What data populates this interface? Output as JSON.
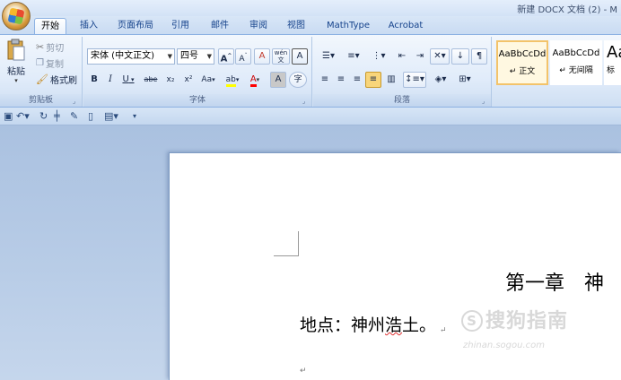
{
  "window": {
    "title": "新建 DOCX 文档 (2) - M"
  },
  "tabs": [
    {
      "label": "开始",
      "active": true
    },
    {
      "label": "插入"
    },
    {
      "label": "页面布局"
    },
    {
      "label": "引用"
    },
    {
      "label": "邮件"
    },
    {
      "label": "审阅"
    },
    {
      "label": "视图"
    },
    {
      "label": "MathType"
    },
    {
      "label": "Acrobat"
    }
  ],
  "clipboard": {
    "group_label": "剪贴板",
    "paste": "粘贴",
    "cut": "剪切",
    "copy": "复制",
    "format_painter": "格式刷"
  },
  "font": {
    "group_label": "字体",
    "font_name": "宋体 (中文正文)",
    "font_size": "四号",
    "grow": "A",
    "shrink": "A",
    "clear": "A",
    "phonetic": "wén",
    "border_char": "A",
    "bold": "B",
    "italic": "I",
    "underline": "U",
    "strike": "abe",
    "subscript": "x₂",
    "superscript": "x²",
    "change_case": "Aa",
    "highlight": "ab",
    "font_color": "A",
    "shade_char": "A",
    "enclose": "字"
  },
  "paragraph": {
    "group_label": "段落"
  },
  "styles": {
    "items": [
      {
        "sample": "AaBbCcDd",
        "name": "正文",
        "selected": true
      },
      {
        "sample": "AaBbCcDd",
        "name": "无间隔"
      },
      {
        "sample": "Aa",
        "name": "标"
      }
    ]
  },
  "document": {
    "heading": "第一章　神",
    "body_prefix": "地点：神州",
    "body_underlined": "浩",
    "body_suffix": "土。",
    "para_mark": "↵"
  },
  "watermark": {
    "text": "搜狗指南",
    "sub": "zhinan.sogou.com",
    "glyph": "S"
  },
  "colors": {
    "accent": "#15428b",
    "ribbon_border": "#8db2e3",
    "highlight": "#ffff00",
    "font_color": "#ff0000"
  }
}
